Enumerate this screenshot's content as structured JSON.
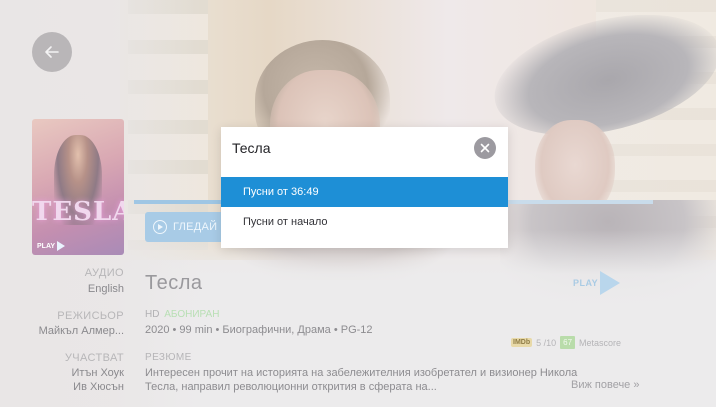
{
  "dialog": {
    "title": "Тесла",
    "options": [
      {
        "label": "Пусни от 36:49",
        "selected": true
      },
      {
        "label": "Пусни от начало",
        "selected": false
      }
    ],
    "close_icon": "close-icon"
  },
  "poster": {
    "title": "TESLA",
    "logo": "PLAY"
  },
  "watch_button": {
    "label": "ГЛЕДАЙ"
  },
  "progress": {
    "fraction": 0.28
  },
  "meta": {
    "audio_label": "АУДИО",
    "audio_value": "English",
    "director_label": "РЕЖИСЬОР",
    "director_value": "Майкъл Алмер...",
    "cast_label": "УЧАСТВАТ",
    "cast": [
      "Итън Хоук",
      "Ив Хюсън"
    ]
  },
  "movie": {
    "title": "Тесла",
    "quality": "HD",
    "subscription": "АБОНИРАН",
    "facts": "2020 • 99 min • Биографични, Драма • PG-12",
    "summary_label": "РЕЗЮМЕ",
    "summary": "Интересен прочит на историята на забележителния изобретател и визионер Никола Тесла, направил революционни открития в сферата на...",
    "more_label": "Виж повече »"
  },
  "ratings": {
    "imdb_label": "IMDb",
    "imdb_value": "5 /10",
    "metascore_value": "67",
    "metascore_label": "Metascore"
  },
  "provider": {
    "name": "PLAY"
  },
  "colors": {
    "accent": "#1e8fd6",
    "subscription": "#b8dfb4"
  }
}
